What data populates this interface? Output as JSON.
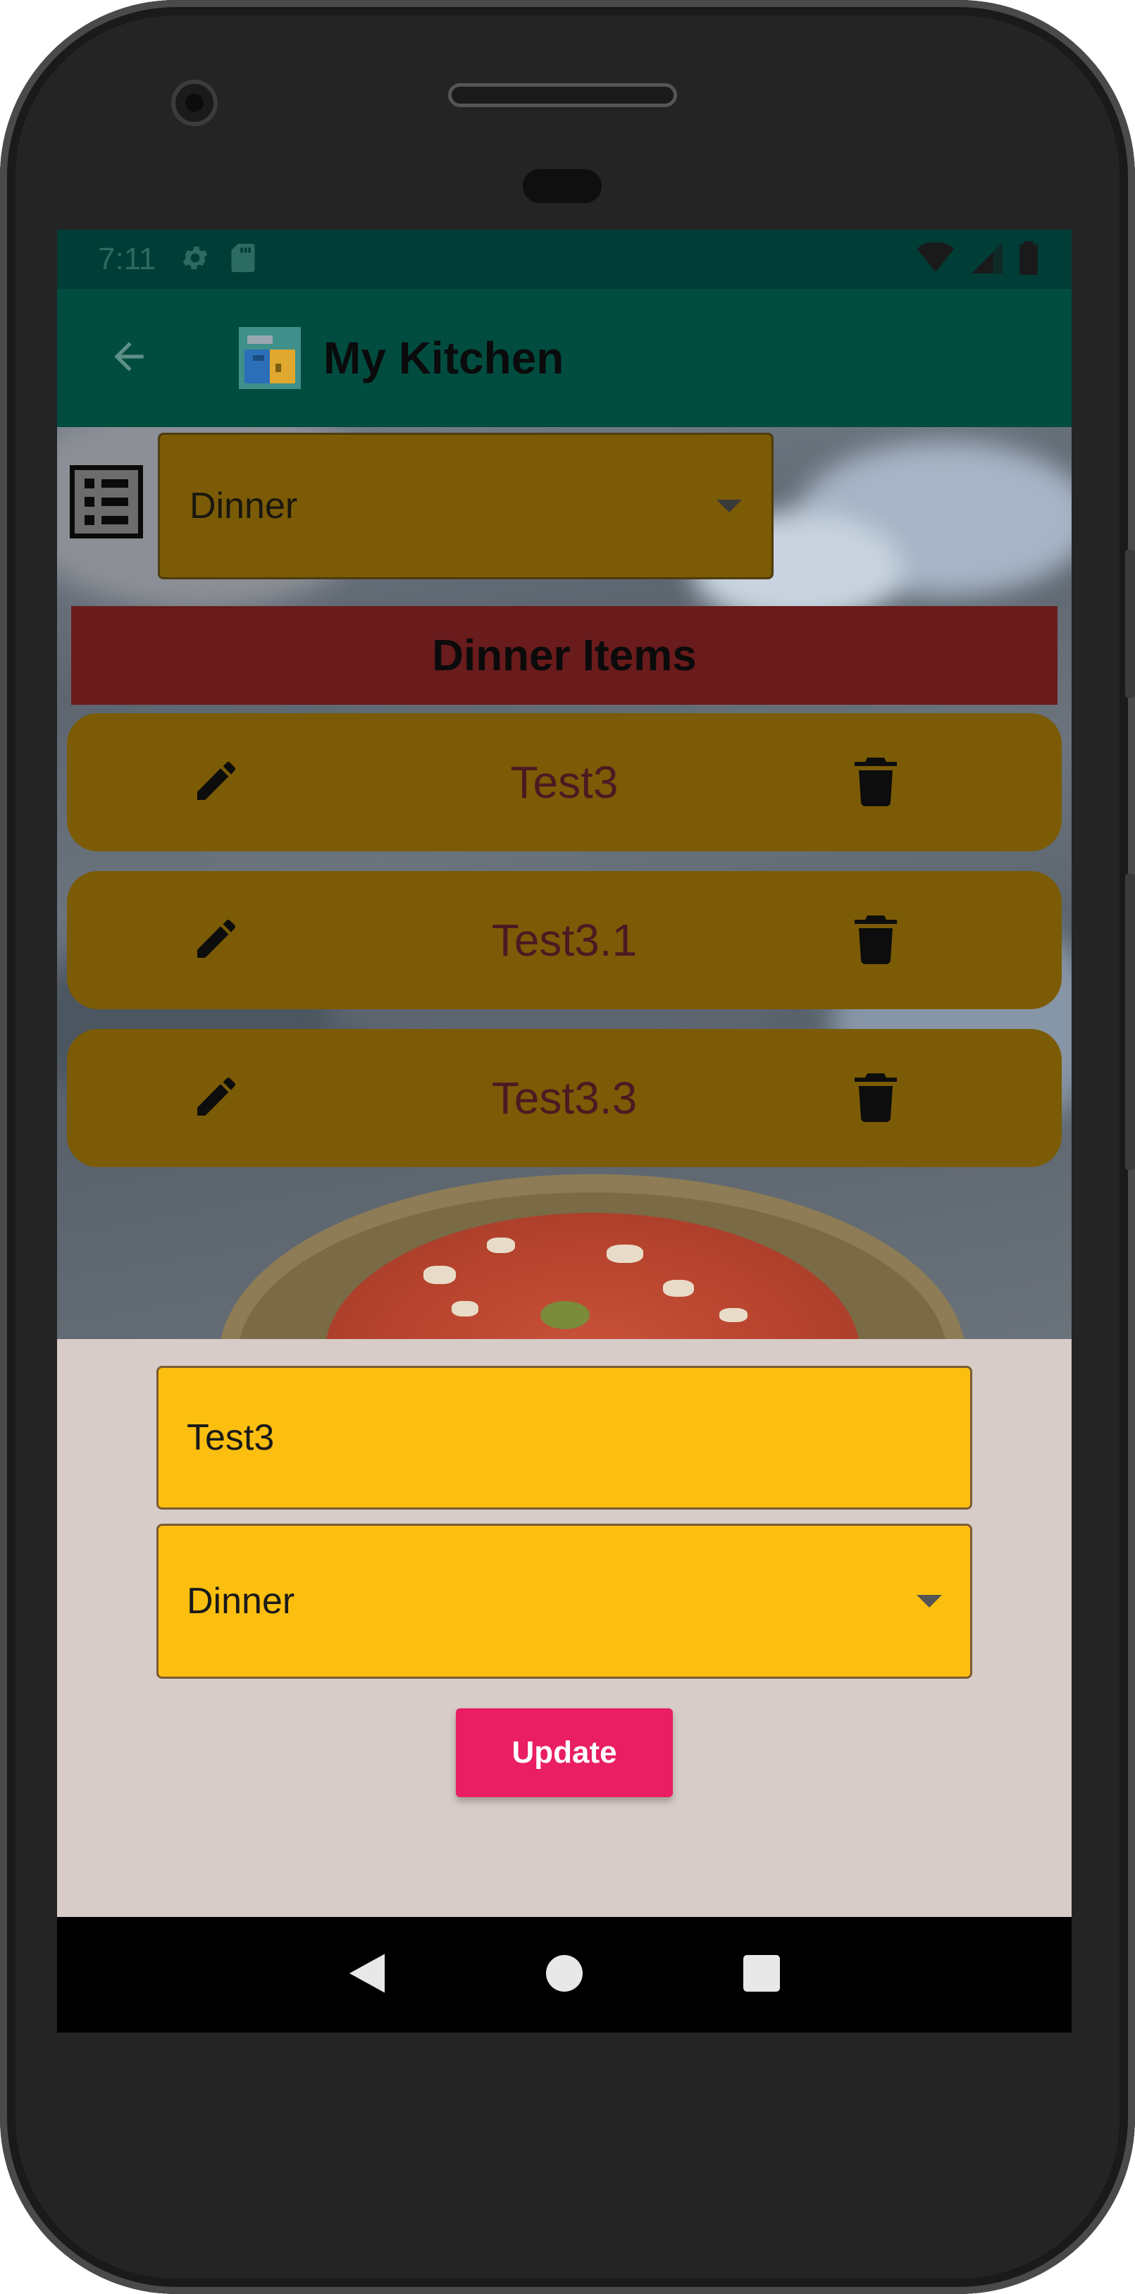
{
  "status_bar": {
    "time": "7:11",
    "icons_left": [
      "settings-icon",
      "sd-card-icon"
    ],
    "icons_right": [
      "wifi-icon",
      "signal-icon",
      "battery-icon"
    ]
  },
  "app_bar": {
    "title": "My Kitchen",
    "back_icon": "arrow-back-icon",
    "logo_icon": "kitchen-logo-icon",
    "background": "#004d40"
  },
  "filter": {
    "selected": "Dinner",
    "list_icon": "list-icon"
  },
  "section": {
    "title": "Dinner Items",
    "background": "#6a1b1c"
  },
  "items": [
    {
      "name": "Test3"
    },
    {
      "name": "Test3.1"
    },
    {
      "name": "Test3.3"
    }
  ],
  "form": {
    "name_value": "Test3",
    "type_selected": "Dinner",
    "update_label": "Update",
    "field_color": "#fdbf0f",
    "button_color": "#e91e63"
  },
  "nav_bar": {
    "icons": [
      "nav-back-icon",
      "nav-home-icon",
      "nav-recents-icon"
    ]
  }
}
